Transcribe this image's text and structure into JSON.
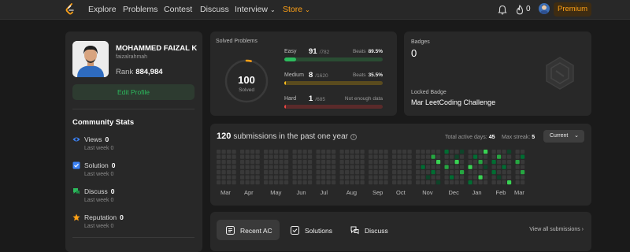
{
  "nav": {
    "items": [
      "Explore",
      "Problems",
      "Contest",
      "Discuss",
      "Interview",
      "Store"
    ],
    "fire_count": "0",
    "premium_label": "Premium"
  },
  "profile": {
    "name": "MOHAMMED FAIZAL K",
    "username": "faizalrahmah",
    "rank_label": "Rank",
    "rank_value": "884,984",
    "edit_label": "Edit Profile"
  },
  "community": {
    "title": "Community Stats",
    "stats": [
      {
        "label": "Views",
        "value": "0",
        "week_label": "Last week",
        "week_value": "0",
        "icon": "eye-icon",
        "color": "#3b82f6"
      },
      {
        "label": "Solution",
        "value": "0",
        "week_label": "Last week",
        "week_value": "0",
        "icon": "solution-icon",
        "color": "#3b82f6"
      },
      {
        "label": "Discuss",
        "value": "0",
        "week_label": "Last week",
        "week_value": "0",
        "icon": "discuss-icon",
        "color": "#2cbb5d"
      },
      {
        "label": "Reputation",
        "value": "0",
        "week_label": "Last week",
        "week_value": "0",
        "icon": "star-icon",
        "color": "#ffa116"
      }
    ]
  },
  "solved": {
    "title": "Solved Problems",
    "total": "100",
    "total_label": "Solved",
    "difficulties": [
      {
        "label": "Easy",
        "solved": "91",
        "total": "/782",
        "beats_label": "Beats",
        "beats": "89.5%",
        "fraction": 0.116,
        "color": "#2cbb5d",
        "track": "#2a4c33"
      },
      {
        "label": "Medium",
        "solved": "8",
        "total": "/1620",
        "beats_label": "Beats",
        "beats": "35.5%",
        "fraction": 0.005,
        "color": "#ffc01e",
        "track": "#5a4b1e"
      },
      {
        "label": "Hard",
        "solved": "1",
        "total": "/685",
        "beats_label": "",
        "beats": "Not enough data",
        "fraction": 0.0015,
        "color": "#ef4743",
        "track": "#5a2a2a"
      }
    ]
  },
  "badges": {
    "title": "Badges",
    "count": "0",
    "locked_label": "Locked Badge",
    "locked_name": "Mar LeetCoding Challenge"
  },
  "submissions": {
    "count": "120",
    "title_text": "submissions in the past one year",
    "active_days_label": "Total active days:",
    "active_days": "45",
    "max_streak_label": "Max streak:",
    "max_streak": "5",
    "period": "Current",
    "months": [
      "Mar",
      "Apr",
      "May",
      "Jun",
      "Jul",
      "Aug",
      "Sep",
      "Oct",
      "Nov",
      "Dec",
      "Jan",
      "Feb",
      "Mar"
    ],
    "weeks_per_month": [
      4,
      4,
      5,
      4,
      4,
      5,
      4,
      4,
      5,
      4,
      4,
      4,
      2
    ],
    "levels": {
      "colors": [
        "#393939",
        "#0e4429",
        "#006d32",
        "#26a641",
        "#39d353"
      ],
      "active": [
        [
          35,
          3,
          2
        ],
        [
          36,
          5,
          1
        ],
        [
          37,
          1,
          3
        ],
        [
          37,
          4,
          2
        ],
        [
          38,
          2,
          4
        ],
        [
          38,
          6,
          1
        ],
        [
          39,
          0,
          2
        ],
        [
          39,
          3,
          3
        ],
        [
          40,
          5,
          2
        ],
        [
          41,
          1,
          1
        ],
        [
          41,
          2,
          4
        ],
        [
          42,
          4,
          3
        ],
        [
          42,
          0,
          1
        ],
        [
          43,
          6,
          2
        ],
        [
          43,
          3,
          4
        ],
        [
          44,
          1,
          2
        ],
        [
          45,
          2,
          3
        ],
        [
          45,
          5,
          4
        ],
        [
          46,
          0,
          4
        ],
        [
          46,
          3,
          1
        ],
        [
          47,
          4,
          2
        ],
        [
          47,
          2,
          2
        ],
        [
          48,
          1,
          3
        ],
        [
          48,
          5,
          1
        ],
        [
          49,
          3,
          2
        ],
        [
          50,
          0,
          1
        ],
        [
          50,
          6,
          4
        ],
        [
          51,
          2,
          3
        ],
        [
          52,
          1,
          2
        ],
        [
          52,
          4,
          3
        ],
        [
          53,
          3,
          1
        ],
        [
          54,
          5,
          2
        ],
        [
          55,
          0,
          3
        ],
        [
          55,
          2,
          4
        ],
        [
          56,
          4,
          1
        ],
        [
          57,
          1,
          2
        ],
        [
          57,
          3,
          3
        ],
        [
          58,
          2,
          1
        ],
        [
          58,
          6,
          2
        ],
        [
          59,
          4,
          3
        ],
        [
          60,
          0,
          2
        ],
        [
          60,
          3,
          4
        ],
        [
          61,
          5,
          1
        ],
        [
          62,
          1,
          3
        ],
        [
          62,
          6,
          4
        ]
      ]
    }
  },
  "recent": {
    "tabs": [
      {
        "label": "Recent AC",
        "icon": "list-icon"
      },
      {
        "label": "Solutions",
        "icon": "solution-icon"
      },
      {
        "label": "Discuss",
        "icon": "discuss-icon"
      }
    ],
    "view_all": "View all submissions"
  }
}
